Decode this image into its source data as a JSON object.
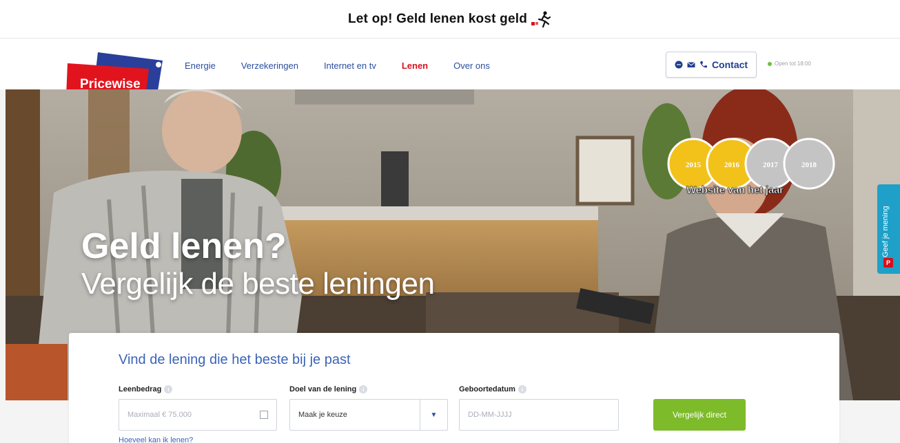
{
  "warning": {
    "text": "Let op! Geld lenen kost geld"
  },
  "logo": {
    "text": "Pricewise"
  },
  "nav": {
    "items": [
      {
        "label": "Energie",
        "active": false
      },
      {
        "label": "Verzekeringen",
        "active": false
      },
      {
        "label": "Internet en tv",
        "active": false
      },
      {
        "label": "Lenen",
        "active": true
      },
      {
        "label": "Over ons",
        "active": false
      }
    ],
    "contact_label": "Contact",
    "open_status": "Open tot 18:00"
  },
  "hero": {
    "title": "Geld lenen?",
    "subtitle": "Vergelijk de beste leningen",
    "awards": {
      "years": [
        "2015",
        "2016",
        "2017",
        "2018"
      ],
      "caption": "Website van het jaar"
    }
  },
  "feedback": {
    "label": "Geef je mening",
    "badge": "P"
  },
  "form": {
    "heading": "Vind de lening die het beste bij je past",
    "fields": [
      {
        "label": "Leenbedrag",
        "placeholder": "Maximaal € 75.000"
      },
      {
        "label": "Doel van de lening",
        "value": "Maak je keuze"
      },
      {
        "label": "Geboortedatum",
        "placeholder": "DD-MM-JJJJ"
      }
    ],
    "submit_label": "Vergelijk direct",
    "help_link": "Hoeveel kan ik lenen?"
  },
  "colors": {
    "brand_red": "#d6111e",
    "nav_blue": "#2a4ea0",
    "heading_blue": "#3a63b8",
    "cta_green": "#7dbb2a",
    "feedback_teal": "#1ea0c8"
  }
}
